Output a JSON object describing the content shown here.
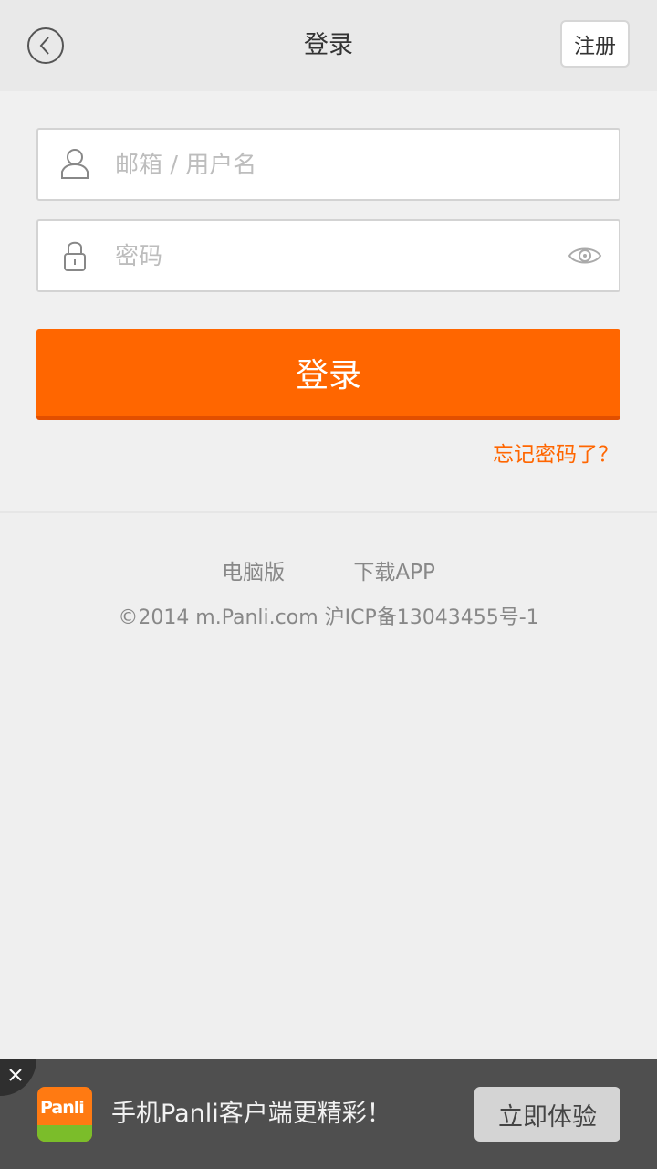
{
  "header": {
    "title": "登录",
    "register_label": "注册",
    "back_icon": "chevron-left-icon"
  },
  "login_form": {
    "username_placeholder": "邮箱 / 用户名",
    "password_placeholder": "密码",
    "user_icon": "user-icon",
    "lock_icon": "lock-icon",
    "eye_icon": "eye-icon",
    "submit_label": "登录",
    "forgot_label": "忘记密码了？"
  },
  "footer": {
    "links": [
      "电脑版",
      "下载APP"
    ],
    "copyright": "©2014 m.Panli.com  沪ICP备13043455号-1"
  },
  "app_banner": {
    "logo_text": "Panli",
    "message": "手机Panli客户端更精彩！",
    "cta_label": "立即体验",
    "close_icon": "close-icon"
  },
  "colors": {
    "accent": "#ff6600",
    "accent_dark": "#e24f00",
    "background": "#efefef",
    "header_bg": "#e9e9e9",
    "banner_bg": "#4f4f4f",
    "link_gray": "#888888"
  }
}
